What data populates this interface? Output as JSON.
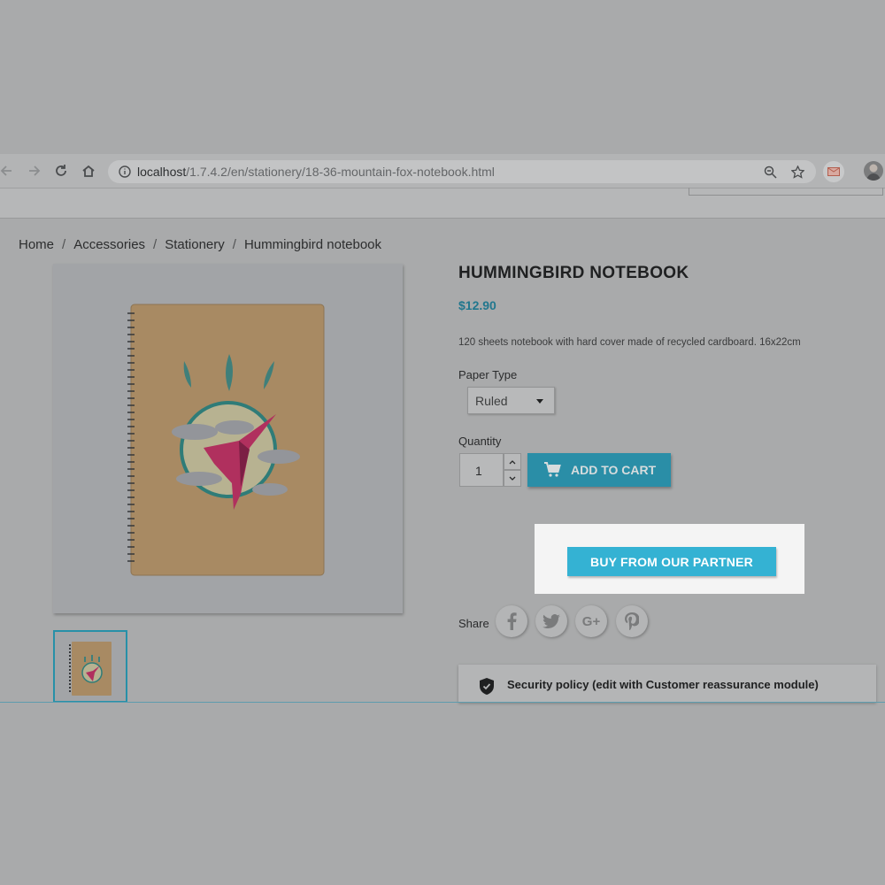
{
  "browser": {
    "url_host": "localhost",
    "url_path": "/1.7.4.2/en/stationery/18-36-mountain-fox-notebook.html"
  },
  "breadcrumb": {
    "items": [
      "Home",
      "Accessories",
      "Stationery",
      "Hummingbird notebook"
    ],
    "separator": "/"
  },
  "product": {
    "title": "HUMMINGBIRD NOTEBOOK",
    "price": "$12.90",
    "description": "120 sheets notebook with hard cover made of recycled cardboard. 16x22cm",
    "paper_type_label": "Paper Type",
    "paper_type_value": "Ruled",
    "quantity_label": "Quantity",
    "quantity_value": "1",
    "add_to_cart_label": "ADD TO CART",
    "partner_button_label": "BUY FROM OUR PARTNER"
  },
  "share": {
    "label": "Share",
    "buttons": [
      {
        "icon": "facebook-icon",
        "glyph": "f"
      },
      {
        "icon": "twitter-icon",
        "glyph": ""
      },
      {
        "icon": "google-plus-icon",
        "glyph": "G+"
      },
      {
        "icon": "pinterest-icon",
        "glyph": "P"
      }
    ]
  },
  "reassurance": {
    "text": "Security policy (edit with Customer reassurance module)",
    "icon": "shield-check-icon"
  },
  "colors": {
    "accent": "#2a8ea7",
    "partner_button": "#34b2d3",
    "highlight_bg": "#f4f4f4",
    "price": "#21778e"
  }
}
